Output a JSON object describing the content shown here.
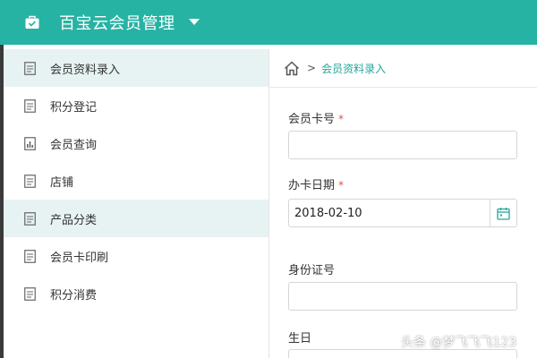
{
  "header": {
    "title": "百宝云会员管理",
    "icon": "briefcase-icon",
    "caret": "caret-down-icon",
    "color": "#26b3a4"
  },
  "sidebar": {
    "items": [
      {
        "label": "会员资料录入",
        "icon": "document-icon",
        "active": true
      },
      {
        "label": "积分登记",
        "icon": "document-icon",
        "active": false
      },
      {
        "label": "会员查询",
        "icon": "bar-chart-icon",
        "active": false
      },
      {
        "label": "店铺",
        "icon": "document-icon",
        "active": false
      },
      {
        "label": "产品分类",
        "icon": "document-icon",
        "active": false
      },
      {
        "label": "会员卡印刷",
        "icon": "document-icon",
        "active": false
      },
      {
        "label": "积分消费",
        "icon": "document-icon",
        "active": false
      }
    ]
  },
  "breadcrumb": {
    "home_icon": "home-icon",
    "separator": ">",
    "current": "会员资料录入"
  },
  "form": {
    "card_number": {
      "label": "会员卡号",
      "required": "*",
      "value": ""
    },
    "card_date": {
      "label": "办卡日期",
      "required": "*",
      "value": "2018-02-10",
      "icon": "calendar-icon"
    },
    "id_number": {
      "label": "身份证号",
      "value": ""
    },
    "birthday": {
      "label": "生日",
      "value": ""
    }
  },
  "watermark": "头条 @梦飞飞飞123"
}
